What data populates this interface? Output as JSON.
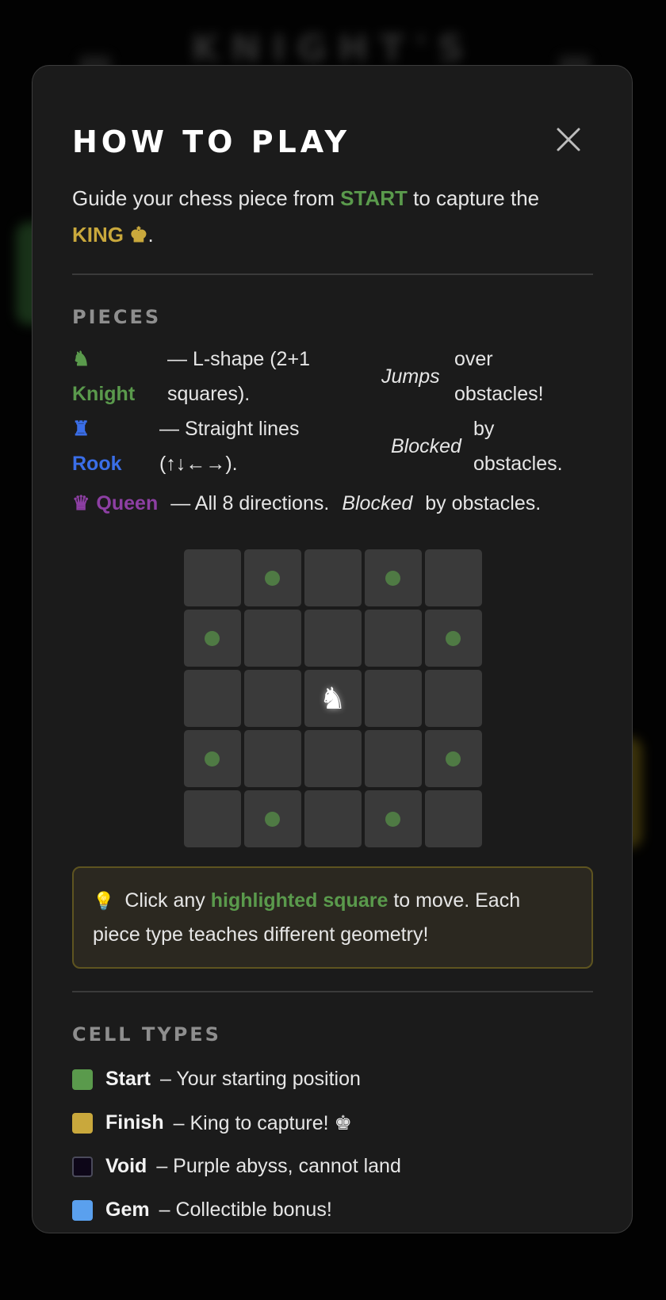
{
  "background": {
    "title": "KNIGHT'S"
  },
  "modal": {
    "title": "HOW TO PLAY",
    "close_icon": "close-icon",
    "intro": {
      "prefix": "Guide your chess piece from",
      "start_word": "START",
      "middle": "to capture the",
      "king_word": "KING",
      "king_glyph": "♚",
      "suffix": "."
    },
    "pieces_title": "PIECES",
    "pieces": [
      {
        "icon": "♞",
        "name": "Knight",
        "desc_a": "— L-shape (2+1",
        "desc_b": "squares).",
        "em": "Jumps",
        "tail_a": "over",
        "tail_b": "obstacles!"
      },
      {
        "icon": "♜",
        "name": "Rook",
        "desc_a": "— Straight lines",
        "desc_b": "(↑↓←→).",
        "em": "Blocked",
        "tail_a": "by",
        "tail_b": "obstacles."
      },
      {
        "icon": "♛",
        "name": "Queen",
        "desc": "— All 8 directions.",
        "em": "Blocked",
        "tail": "by obstacles."
      }
    ],
    "demo_board": {
      "size": 5,
      "piece": "♞",
      "piece_position": [
        2,
        2
      ],
      "highlighted_moves": [
        [
          0,
          1
        ],
        [
          0,
          3
        ],
        [
          1,
          0
        ],
        [
          1,
          4
        ],
        [
          3,
          0
        ],
        [
          3,
          4
        ],
        [
          4,
          1
        ],
        [
          4,
          3
        ]
      ]
    },
    "tip": {
      "icon": "💡",
      "prefix": "Click any",
      "highlight": "highlighted square",
      "suffix": "to move. Each piece type teaches different geometry!"
    },
    "cell_types_title": "CELL TYPES",
    "cell_types": [
      {
        "name": "Start",
        "desc": "– Your starting position",
        "color": "#5a9a4c"
      },
      {
        "name": "Finish",
        "desc": "– King to capture! ♚",
        "color": "#c9a83c"
      },
      {
        "name": "Void",
        "desc": "– Purple abyss, cannot land",
        "color": "#0d0618"
      },
      {
        "name": "Gem",
        "desc": "– Collectible bonus!",
        "color": "#5aa0ee"
      }
    ]
  },
  "colors": {
    "green": "#5a9a4c",
    "gold": "#c9a83c",
    "rook_blue": "#3a6ee8",
    "queen_purple": "#8d3fa3"
  }
}
